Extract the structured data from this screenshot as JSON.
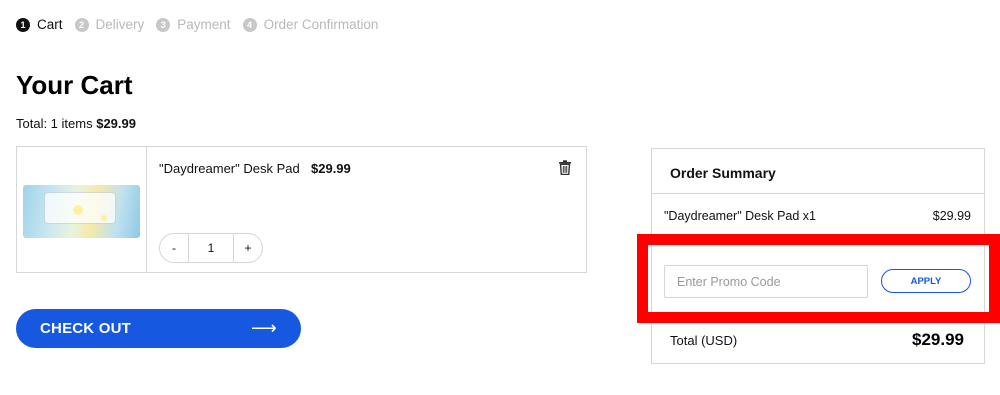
{
  "steps": [
    {
      "num": "1",
      "label": "Cart",
      "active": true
    },
    {
      "num": "2",
      "label": "Delivery",
      "active": false
    },
    {
      "num": "3",
      "label": "Payment",
      "active": false
    },
    {
      "num": "4",
      "label": "Order Confirmation",
      "active": false
    }
  ],
  "cart": {
    "title": "Your Cart",
    "total_prefix": "Total: 1 items",
    "total_amount": "$29.99",
    "item": {
      "name": "\"Daydreamer\" Desk Pad",
      "price": "$29.99",
      "qty": "1",
      "minus": "-",
      "plus": "+"
    },
    "checkout_label": "CHECK OUT",
    "checkout_arrow": "⟶"
  },
  "summary": {
    "heading": "Order Summary",
    "line_item": "\"Daydreamer\" Desk Pad x1",
    "line_price": "$29.99",
    "promo_placeholder": "Enter Promo Code",
    "apply_label": "APPLY",
    "total_label": "Total (USD)",
    "total_value": "$29.99"
  },
  "colors": {
    "accent": "#1659e0",
    "highlight": "#ff0000",
    "border": "#d6d6d6"
  },
  "icons": {
    "trash": "trash-icon",
    "arrow": "arrow-right-icon"
  }
}
